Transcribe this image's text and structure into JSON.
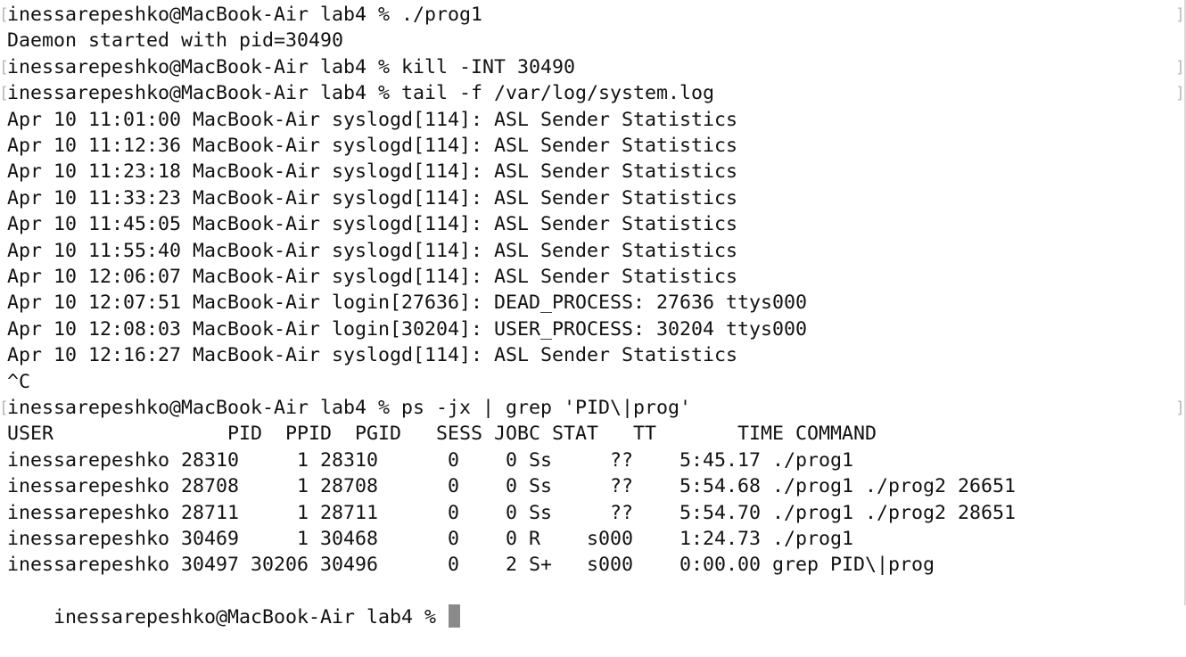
{
  "prompt": "inessarepeshko@MacBook-Air lab4 % ",
  "lines": [
    {
      "text": "inessarepeshko@MacBook-Air lab4 % ./prog1",
      "bracket": true
    },
    {
      "text": "Daemon started with pid=30490",
      "bracket": false
    },
    {
      "text": "inessarepeshko@MacBook-Air lab4 % kill -INT 30490",
      "bracket": true
    },
    {
      "text": "inessarepeshko@MacBook-Air lab4 % tail -f /var/log/system.log",
      "bracket": true
    },
    {
      "text": "Apr 10 11:01:00 MacBook-Air syslogd[114]: ASL Sender Statistics",
      "bracket": false
    },
    {
      "text": "Apr 10 11:12:36 MacBook-Air syslogd[114]: ASL Sender Statistics",
      "bracket": false
    },
    {
      "text": "Apr 10 11:23:18 MacBook-Air syslogd[114]: ASL Sender Statistics",
      "bracket": false
    },
    {
      "text": "Apr 10 11:33:23 MacBook-Air syslogd[114]: ASL Sender Statistics",
      "bracket": false
    },
    {
      "text": "Apr 10 11:45:05 MacBook-Air syslogd[114]: ASL Sender Statistics",
      "bracket": false
    },
    {
      "text": "Apr 10 11:55:40 MacBook-Air syslogd[114]: ASL Sender Statistics",
      "bracket": false
    },
    {
      "text": "Apr 10 12:06:07 MacBook-Air syslogd[114]: ASL Sender Statistics",
      "bracket": false
    },
    {
      "text": "Apr 10 12:07:51 MacBook-Air login[27636]: DEAD_PROCESS: 27636 ttys000",
      "bracket": false
    },
    {
      "text": "Apr 10 12:08:03 MacBook-Air login[30204]: USER_PROCESS: 30204 ttys000",
      "bracket": false
    },
    {
      "text": "Apr 10 12:16:27 MacBook-Air syslogd[114]: ASL Sender Statistics",
      "bracket": false
    },
    {
      "text": "^C",
      "bracket": false
    },
    {
      "text": "inessarepeshko@MacBook-Air lab4 % ps -jx | grep 'PID\\|prog'",
      "bracket": true
    },
    {
      "text": "USER               PID  PPID  PGID   SESS JOBC STAT   TT       TIME COMMAND",
      "bracket": false
    },
    {
      "text": "inessarepeshko 28310     1 28310      0    0 Ss     ??    5:45.17 ./prog1",
      "bracket": false
    },
    {
      "text": "inessarepeshko 28708     1 28708      0    0 Ss     ??    5:54.68 ./prog1 ./prog2 26651",
      "bracket": false
    },
    {
      "text": "inessarepeshko 28711     1 28711      0    0 Ss     ??    5:54.70 ./prog1 ./prog2 28651",
      "bracket": false
    },
    {
      "text": "inessarepeshko 30469     1 30468      0    0 R    s000    1:24.73 ./prog1",
      "bracket": false
    },
    {
      "text": "inessarepeshko 30497 30206 30496      0    2 S+   s000    0:00.00 grep PID\\|prog",
      "bracket": false
    }
  ]
}
